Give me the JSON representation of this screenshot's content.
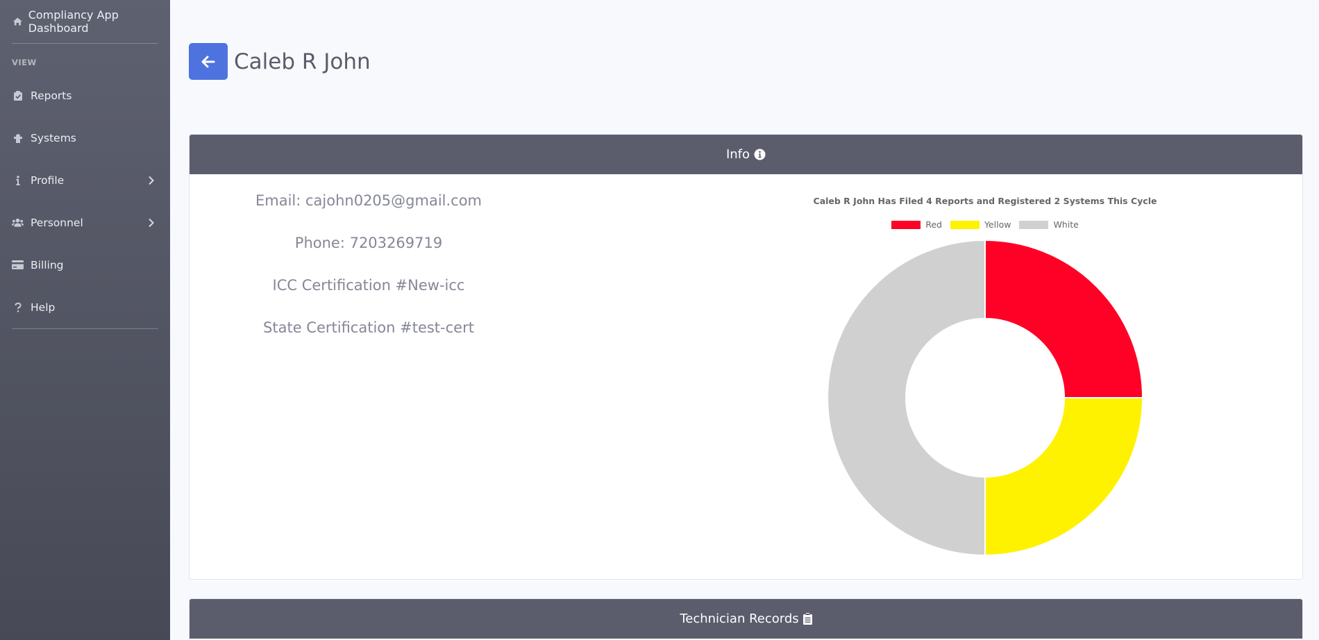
{
  "sidebar": {
    "brand": "Compliancy App Dashboard",
    "section_heading": "VIEW",
    "items": [
      {
        "label": "Reports",
        "icon": "clipboard-check-icon"
      },
      {
        "label": "Systems",
        "icon": "fire-hydrant-icon"
      },
      {
        "label": "Profile",
        "icon": "info-icon",
        "has_submenu": true
      },
      {
        "label": "Personnel",
        "icon": "users-icon",
        "has_submenu": true
      },
      {
        "label": "Billing",
        "icon": "credit-card-icon"
      },
      {
        "label": "Help",
        "icon": "question-icon"
      }
    ]
  },
  "header": {
    "title": "Caleb R John"
  },
  "info_card": {
    "title": "Info",
    "email": "Email: cajohn0205@gmail.com",
    "phone": "Phone: 7203269719",
    "icc_cert": "ICC Certification #New-icc",
    "state_cert": "State Certification #test-cert"
  },
  "tech_card": {
    "title": "Technician Records"
  },
  "colors": {
    "accent": "#4e73df",
    "card_header": "#5b5d6c",
    "red": "#ff0026",
    "yellow": "#fff200",
    "white_series": "#d0d0d0"
  },
  "chart_data": {
    "type": "pie",
    "title": "Caleb R John Has Filed 4 Reports and Registered 2 Systems This Cycle",
    "labels": [
      "Red",
      "Yellow",
      "White"
    ],
    "values": [
      1,
      1,
      2
    ],
    "colors": [
      "#ff0026",
      "#fff200",
      "#d0d0d0"
    ],
    "legend": "top"
  }
}
